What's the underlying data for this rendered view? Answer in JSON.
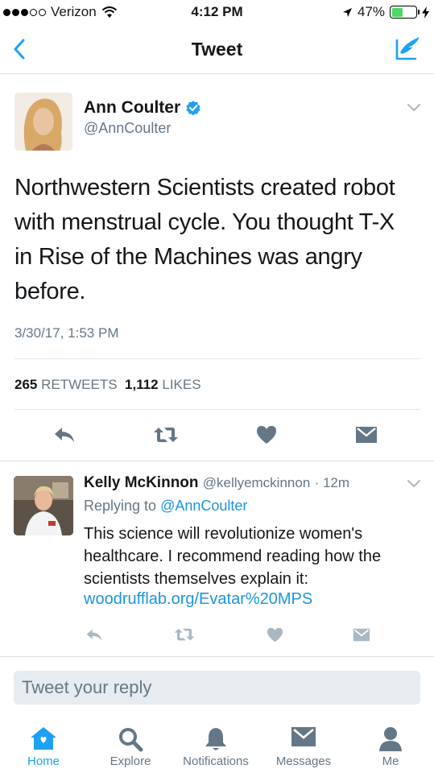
{
  "status_bar": {
    "carrier": "Verizon",
    "time": "4:12 PM",
    "battery_percent": "47%",
    "battery_level": 0.47
  },
  "nav": {
    "title": "Tweet"
  },
  "tweet": {
    "author_name": "Ann Coulter",
    "author_handle": "@AnnCoulter",
    "text": "Northwestern Scientists created robot with menstrual cycle. You thought T-X in Rise of the Machines was angry before.",
    "timestamp": "3/30/17, 1:53 PM",
    "retweets_count": "265",
    "retweets_label": "RETWEETS",
    "likes_count": "1,112",
    "likes_label": "LIKES"
  },
  "reply": {
    "author_name": "Kelly McKinnon",
    "author_handle": "@kellyemckinnon",
    "time_ago": "· 12m",
    "replying_to_prefix": "Replying to",
    "replying_to_handle": "@AnnCoulter",
    "text": "This science will revolutionize women's healthcare. I recommend reading how the scientists themselves explain it:",
    "link": "woodrufflab.org/Evatar%20MPS"
  },
  "reply_box": {
    "placeholder": "Tweet your reply"
  },
  "tabs": [
    {
      "label": "Home",
      "icon": "home-icon",
      "active": true
    },
    {
      "label": "Explore",
      "icon": "search-icon",
      "active": false
    },
    {
      "label": "Notifications",
      "icon": "bell-icon",
      "active": false
    },
    {
      "label": "Messages",
      "icon": "envelope-icon",
      "active": false
    },
    {
      "label": "Me",
      "icon": "person-icon",
      "active": false
    }
  ],
  "colors": {
    "accent": "#1da1f2",
    "link": "#1b95e0",
    "muted": "#657786",
    "icon_gray": "#8899a6"
  }
}
